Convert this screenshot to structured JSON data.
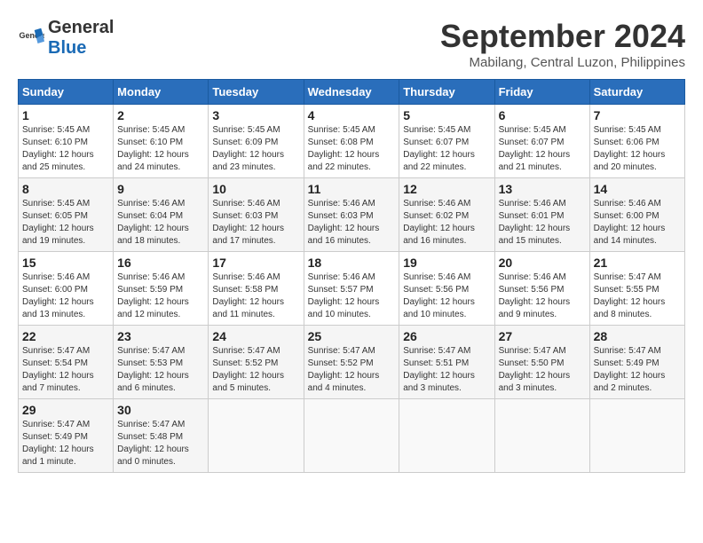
{
  "header": {
    "logo_general": "General",
    "logo_blue": "Blue",
    "month_year": "September 2024",
    "location": "Mabilang, Central Luzon, Philippines"
  },
  "weekdays": [
    "Sunday",
    "Monday",
    "Tuesday",
    "Wednesday",
    "Thursday",
    "Friday",
    "Saturday"
  ],
  "weeks": [
    [
      {
        "day": "1",
        "sunrise": "5:45 AM",
        "sunset": "6:10 PM",
        "daylight": "12 hours and 25 minutes."
      },
      {
        "day": "2",
        "sunrise": "5:45 AM",
        "sunset": "6:10 PM",
        "daylight": "12 hours and 24 minutes."
      },
      {
        "day": "3",
        "sunrise": "5:45 AM",
        "sunset": "6:09 PM",
        "daylight": "12 hours and 23 minutes."
      },
      {
        "day": "4",
        "sunrise": "5:45 AM",
        "sunset": "6:08 PM",
        "daylight": "12 hours and 22 minutes."
      },
      {
        "day": "5",
        "sunrise": "5:45 AM",
        "sunset": "6:07 PM",
        "daylight": "12 hours and 22 minutes."
      },
      {
        "day": "6",
        "sunrise": "5:45 AM",
        "sunset": "6:07 PM",
        "daylight": "12 hours and 21 minutes."
      },
      {
        "day": "7",
        "sunrise": "5:45 AM",
        "sunset": "6:06 PM",
        "daylight": "12 hours and 20 minutes."
      }
    ],
    [
      {
        "day": "8",
        "sunrise": "5:45 AM",
        "sunset": "6:05 PM",
        "daylight": "12 hours and 19 minutes."
      },
      {
        "day": "9",
        "sunrise": "5:46 AM",
        "sunset": "6:04 PM",
        "daylight": "12 hours and 18 minutes."
      },
      {
        "day": "10",
        "sunrise": "5:46 AM",
        "sunset": "6:03 PM",
        "daylight": "12 hours and 17 minutes."
      },
      {
        "day": "11",
        "sunrise": "5:46 AM",
        "sunset": "6:03 PM",
        "daylight": "12 hours and 16 minutes."
      },
      {
        "day": "12",
        "sunrise": "5:46 AM",
        "sunset": "6:02 PM",
        "daylight": "12 hours and 16 minutes."
      },
      {
        "day": "13",
        "sunrise": "5:46 AM",
        "sunset": "6:01 PM",
        "daylight": "12 hours and 15 minutes."
      },
      {
        "day": "14",
        "sunrise": "5:46 AM",
        "sunset": "6:00 PM",
        "daylight": "12 hours and 14 minutes."
      }
    ],
    [
      {
        "day": "15",
        "sunrise": "5:46 AM",
        "sunset": "6:00 PM",
        "daylight": "12 hours and 13 minutes."
      },
      {
        "day": "16",
        "sunrise": "5:46 AM",
        "sunset": "5:59 PM",
        "daylight": "12 hours and 12 minutes."
      },
      {
        "day": "17",
        "sunrise": "5:46 AM",
        "sunset": "5:58 PM",
        "daylight": "12 hours and 11 minutes."
      },
      {
        "day": "18",
        "sunrise": "5:46 AM",
        "sunset": "5:57 PM",
        "daylight": "12 hours and 10 minutes."
      },
      {
        "day": "19",
        "sunrise": "5:46 AM",
        "sunset": "5:56 PM",
        "daylight": "12 hours and 10 minutes."
      },
      {
        "day": "20",
        "sunrise": "5:46 AM",
        "sunset": "5:56 PM",
        "daylight": "12 hours and 9 minutes."
      },
      {
        "day": "21",
        "sunrise": "5:47 AM",
        "sunset": "5:55 PM",
        "daylight": "12 hours and 8 minutes."
      }
    ],
    [
      {
        "day": "22",
        "sunrise": "5:47 AM",
        "sunset": "5:54 PM",
        "daylight": "12 hours and 7 minutes."
      },
      {
        "day": "23",
        "sunrise": "5:47 AM",
        "sunset": "5:53 PM",
        "daylight": "12 hours and 6 minutes."
      },
      {
        "day": "24",
        "sunrise": "5:47 AM",
        "sunset": "5:52 PM",
        "daylight": "12 hours and 5 minutes."
      },
      {
        "day": "25",
        "sunrise": "5:47 AM",
        "sunset": "5:52 PM",
        "daylight": "12 hours and 4 minutes."
      },
      {
        "day": "26",
        "sunrise": "5:47 AM",
        "sunset": "5:51 PM",
        "daylight": "12 hours and 3 minutes."
      },
      {
        "day": "27",
        "sunrise": "5:47 AM",
        "sunset": "5:50 PM",
        "daylight": "12 hours and 3 minutes."
      },
      {
        "day": "28",
        "sunrise": "5:47 AM",
        "sunset": "5:49 PM",
        "daylight": "12 hours and 2 minutes."
      }
    ],
    [
      {
        "day": "29",
        "sunrise": "5:47 AM",
        "sunset": "5:49 PM",
        "daylight": "12 hours and 1 minute."
      },
      {
        "day": "30",
        "sunrise": "5:47 AM",
        "sunset": "5:48 PM",
        "daylight": "12 hours and 0 minutes."
      },
      null,
      null,
      null,
      null,
      null
    ]
  ],
  "labels": {
    "sunrise_prefix": "Sunrise: ",
    "sunset_prefix": "Sunset: ",
    "daylight_prefix": "Daylight: "
  }
}
